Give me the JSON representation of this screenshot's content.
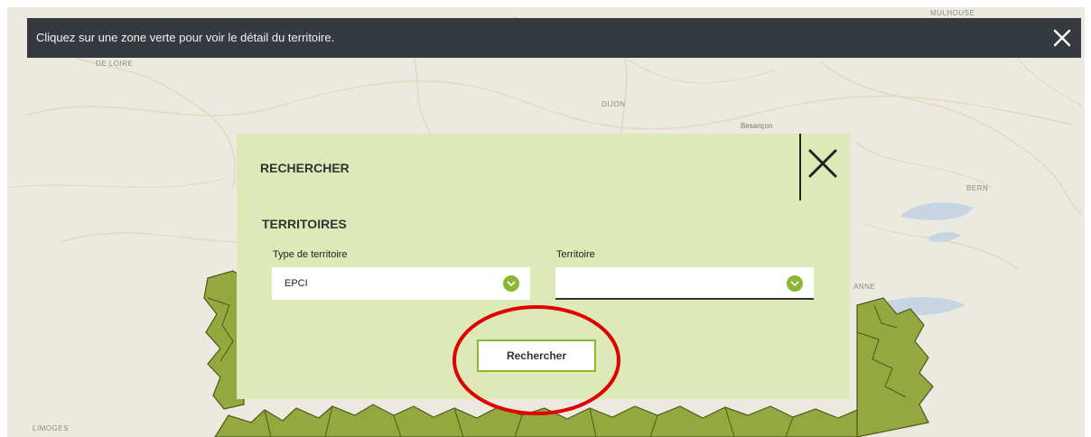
{
  "notice": {
    "text": "Cliquez sur une zone verte pour voir le détail du territoire."
  },
  "map": {
    "labels": {
      "mulhouse": "MULHOUSE",
      "de_loire": "DE LOIRE",
      "dijon": "DIJON",
      "besancon": "Besançon",
      "bern": "BERN",
      "lausanne_partial": "ANNE",
      "limoges": "LIMOGES"
    }
  },
  "modal": {
    "title": "RECHERCHER",
    "section_title": "TERRITOIRES",
    "type_label": "Type de territoire",
    "type_value": "EPCI",
    "territory_label": "Territoire",
    "territory_value": "",
    "search_button": "Rechercher"
  },
  "colors": {
    "notice_bg": "#343a40",
    "modal_bg": "#dde9b7",
    "accent_green": "#8ab832",
    "territory_fill": "#95a83f",
    "territory_stroke": "#4a5a16",
    "highlight_red": "#e00000"
  },
  "icons": {
    "notice_close": "close-icon",
    "modal_close": "close-icon",
    "select_arrow": "chevron-down-icon"
  }
}
